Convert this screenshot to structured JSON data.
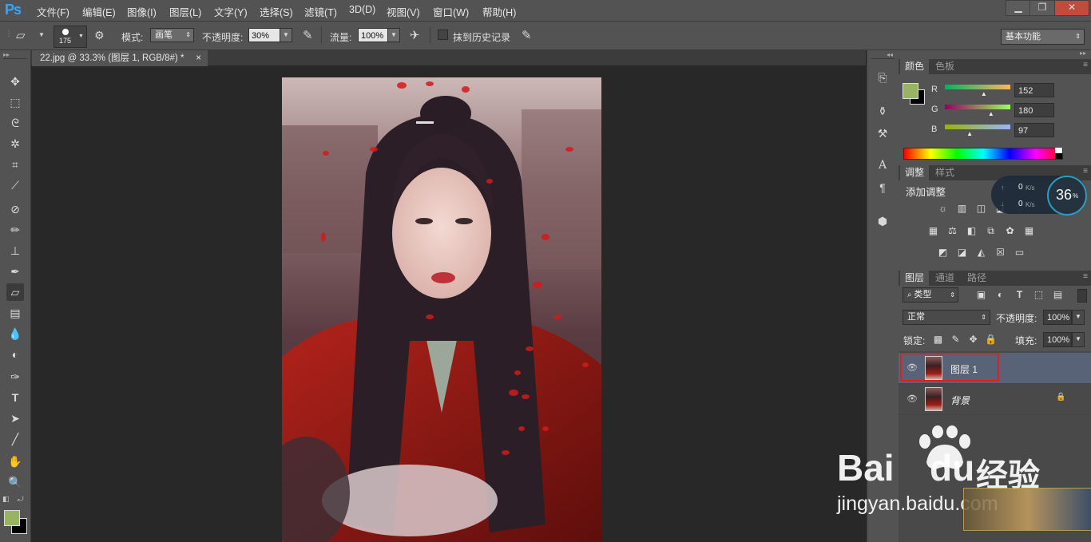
{
  "app": {
    "logo": "Ps"
  },
  "menu": [
    "文件(F)",
    "编辑(E)",
    "图像(I)",
    "图层(L)",
    "文字(Y)",
    "选择(S)",
    "滤镜(T)",
    "3D(D)",
    "视图(V)",
    "窗口(W)",
    "帮助(H)"
  ],
  "window_controls": {
    "minimize": "▁",
    "restore": "❐",
    "close": "✕"
  },
  "options": {
    "brush_size": "175",
    "mode_label": "模式:",
    "mode_value": "画笔",
    "opacity_label": "不透明度:",
    "opacity_value": "30%",
    "flow_label": "流量:",
    "flow_value": "100%",
    "erase_history_label": "抹到历史记录",
    "workspace": "基本功能"
  },
  "document": {
    "tab_title": "22.jpg @ 33.3% (图层 1, RGB/8#) *",
    "close": "×"
  },
  "color_panel": {
    "tabs": [
      "颜色",
      "色板"
    ],
    "r_label": "R",
    "g_label": "G",
    "b_label": "B",
    "r": "152",
    "g": "180",
    "b": "97",
    "foreground": "#98b461",
    "r_fraction": 0.596,
    "g_fraction": 0.706,
    "b_fraction": 0.38
  },
  "adjustments_panel": {
    "tabs": [
      "调整",
      "样式"
    ],
    "title": "添加调整"
  },
  "net_widget": {
    "up": "0",
    "down": "0",
    "unit": "K/s",
    "percent": "36",
    "percent_sign": "%"
  },
  "layers_panel": {
    "tabs": [
      "图层",
      "通道",
      "路径"
    ],
    "filter_kind": "类型",
    "blend_mode": "正常",
    "opacity_label": "不透明度:",
    "opacity_value": "100%",
    "lock_label": "锁定:",
    "fill_label": "填充:",
    "fill_value": "100%",
    "layers": [
      {
        "name": "图层 1",
        "selected": true
      },
      {
        "name": "背景",
        "locked": true
      }
    ]
  },
  "watermark": {
    "brand": "Bai",
    "brand2": "du",
    "jingyan": "经验",
    "url": "jingyan.baidu.com"
  }
}
